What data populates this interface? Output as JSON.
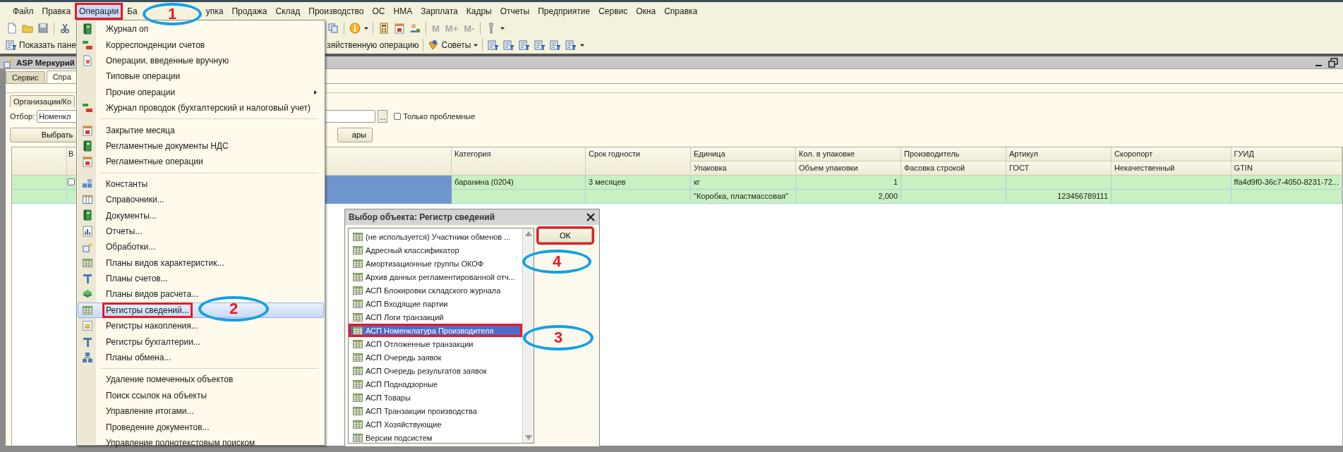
{
  "menubar": {
    "items": [
      {
        "label": "Файл",
        "selected": false,
        "highlighted": false
      },
      {
        "label": "Правка",
        "selected": false,
        "highlighted": false
      },
      {
        "label": "Операции",
        "selected": true,
        "highlighted": true
      },
      {
        "label": "Ба",
        "selected": false,
        "highlighted": false
      },
      {
        "label": "упка",
        "selected": false,
        "highlighted": false
      },
      {
        "label": "Продажа",
        "selected": false,
        "highlighted": false
      },
      {
        "label": "Склад",
        "selected": false,
        "highlighted": false
      },
      {
        "label": "Производство",
        "selected": false,
        "highlighted": false
      },
      {
        "label": "ОС",
        "selected": false,
        "highlighted": false
      },
      {
        "label": "НМА",
        "selected": false,
        "highlighted": false
      },
      {
        "label": "Зарплата",
        "selected": false,
        "highlighted": false
      },
      {
        "label": "Кадры",
        "selected": false,
        "highlighted": false
      },
      {
        "label": "Отчеты",
        "selected": false,
        "highlighted": false
      },
      {
        "label": "Предприятие",
        "selected": false,
        "highlighted": false
      },
      {
        "label": "Сервис",
        "selected": false,
        "highlighted": false
      },
      {
        "label": "Окна",
        "selected": false,
        "highlighted": false
      },
      {
        "label": "Справка",
        "selected": false,
        "highlighted": false
      }
    ]
  },
  "toolbar": {
    "memory_keys": [
      {
        "label": "M",
        "disabled": true
      },
      {
        "label": "M+",
        "disabled": true
      },
      {
        "label": "M-",
        "disabled": true
      }
    ],
    "panel_button": "Показать пане",
    "operation_button": "зяйственную операцию",
    "tips_button": "Советы"
  },
  "document": {
    "title": "ASP Меркурий",
    "tabs": [
      {
        "label": "Сервис",
        "selected": false
      },
      {
        "label": "Спра",
        "selected": true
      }
    ],
    "inner_tabs": [
      {
        "label": "Организации/Ко",
        "selected": true
      }
    ],
    "filter": {
      "label": "Отбор:",
      "value": "Номенкл",
      "select_button": "...",
      "only_problems": {
        "label": "Только проблемные",
        "checked": false
      }
    },
    "buttons": [
      "Выбрать",
      "ары"
    ],
    "table": {
      "columns": [
        {
          "header": "В"
        },
        {},
        {
          "header": "Категория"
        },
        {
          "header": "Срок годности"
        },
        {
          "header": "Единица",
          "subheader": "Упаковка"
        },
        {
          "header": "Кол. в упаковке",
          "subheader": "Объем упаковки"
        },
        {
          "header": "Производитель",
          "subheader": "Фасовка строкой"
        },
        {
          "header": "Артикул",
          "subheader": "ГОСТ"
        },
        {
          "header": "Скоропорт",
          "subheader": "Некачественный"
        },
        {
          "header": "ГУИД",
          "subheader": "GTIN"
        }
      ],
      "rows": [
        {
          "selected": true,
          "checked": false,
          "lines": [
            {
              "category": "баранина (0204)",
              "shelf_life": "3 месяцев",
              "unit": "кг",
              "pack_qty": "1",
              "guid": "ffa4d9f0-36c7-4050-8231-72..."
            },
            {
              "package": "\"Коробка, пластмассовая\"",
              "pack_volume": "2,000",
              "gost": "123456789111"
            }
          ]
        }
      ]
    }
  },
  "menu": {
    "groups": [
      {
        "items": [
          {
            "label": "Журнал оп",
            "selected": false,
            "highlighted": false,
            "submenu": false
          },
          {
            "label": "Корреспонденции счетов",
            "selected": false,
            "highlighted": false,
            "submenu": false
          },
          {
            "label": "Операции, введенные вручную",
            "selected": false,
            "highlighted": false,
            "submenu": false
          },
          {
            "label": "Типовые операции",
            "selected": false,
            "highlighted": false,
            "submenu": false
          },
          {
            "label": "Прочие операции",
            "selected": false,
            "highlighted": false,
            "submenu": true
          },
          {
            "label": "Журнал проводок (бухгалтерский и налоговый учет)",
            "selected": false,
            "highlighted": false,
            "submenu": false
          }
        ]
      },
      {
        "items": [
          {
            "label": "Закрытие месяца",
            "selected": false,
            "highlighted": false,
            "submenu": false
          },
          {
            "label": "Регламентные документы НДС",
            "selected": false,
            "highlighted": false,
            "submenu": false
          },
          {
            "label": "Регламентные операции",
            "selected": false,
            "highlighted": false,
            "submenu": false
          }
        ]
      },
      {
        "items": [
          {
            "label": "Константы",
            "selected": false,
            "highlighted": false,
            "submenu": false
          },
          {
            "label": "Справочники...",
            "selected": false,
            "highlighted": false,
            "submenu": false
          },
          {
            "label": "Документы...",
            "selected": false,
            "highlighted": false,
            "submenu": false
          },
          {
            "label": "Отчеты...",
            "selected": false,
            "highlighted": false,
            "submenu": false
          },
          {
            "label": "Обработки...",
            "selected": false,
            "highlighted": false,
            "submenu": false
          },
          {
            "label": "Планы видов характеристик...",
            "selected": false,
            "highlighted": false,
            "submenu": false
          },
          {
            "label": "Планы счетов...",
            "selected": false,
            "highlighted": false,
            "submenu": false
          },
          {
            "label": "Планы видов расчета...",
            "selected": false,
            "highlighted": false,
            "submenu": false
          },
          {
            "label": "Регистры сведений...",
            "selected": true,
            "highlighted": true,
            "submenu": false
          },
          {
            "label": "Регистры накопления...",
            "selected": false,
            "highlighted": false,
            "submenu": false
          },
          {
            "label": "Регистры бухгалтерии...",
            "selected": false,
            "highlighted": false,
            "submenu": false
          },
          {
            "label": "Планы обмена...",
            "selected": false,
            "highlighted": false,
            "submenu": false
          }
        ]
      },
      {
        "items": [
          {
            "label": "Удаление помеченных объектов",
            "selected": false,
            "highlighted": false,
            "submenu": false
          },
          {
            "label": "Поиск ссылок на объекты",
            "selected": false,
            "highlighted": false,
            "submenu": false
          },
          {
            "label": "Управление итогами...",
            "selected": false,
            "highlighted": false,
            "submenu": false
          },
          {
            "label": "Проведение документов...",
            "selected": false,
            "highlighted": false,
            "submenu": false
          },
          {
            "label": "Управление полнотекстовым поиском",
            "selected": false,
            "highlighted": false,
            "submenu": false
          }
        ]
      }
    ]
  },
  "dialog": {
    "title": "Выбор объекта: Регистр сведений",
    "ok": {
      "label": "OK",
      "highlighted": true
    },
    "items": [
      {
        "label": "(не используется) Участники обменов ...",
        "selected": false,
        "highlighted": false
      },
      {
        "label": "Адресный классификатор",
        "selected": false,
        "highlighted": false
      },
      {
        "label": "Амортизационные группы ОКОФ",
        "selected": false,
        "highlighted": false
      },
      {
        "label": "Архив данных регламентированной отч...",
        "selected": false,
        "highlighted": false
      },
      {
        "label": "АСП Блокировки складского журнала",
        "selected": false,
        "highlighted": false
      },
      {
        "label": "АСП Входящие партии",
        "selected": false,
        "highlighted": false
      },
      {
        "label": "АСП Логи транзакций",
        "selected": false,
        "highlighted": false
      },
      {
        "label": "АСП Номенклатура Производителя",
        "selected": true,
        "highlighted": true
      },
      {
        "label": "АСП Отложенные транзакции",
        "selected": false,
        "highlighted": false
      },
      {
        "label": "АСП Очередь заявок",
        "selected": false,
        "highlighted": false
      },
      {
        "label": "АСП Очередь результатов заявок",
        "selected": false,
        "highlighted": false
      },
      {
        "label": "АСП Поднадзорные",
        "selected": false,
        "highlighted": false
      },
      {
        "label": "АСП Товары",
        "selected": false,
        "highlighted": false
      },
      {
        "label": "АСП Транзакции производства",
        "selected": false,
        "highlighted": false
      },
      {
        "label": "АСП Хозяйствующие",
        "selected": false,
        "highlighted": false
      },
      {
        "label": "Версии подсистем",
        "selected": false,
        "highlighted": false
      }
    ]
  },
  "callouts": [
    {
      "label": "1"
    },
    {
      "label": "2"
    },
    {
      "label": "3"
    },
    {
      "label": "4"
    }
  ]
}
